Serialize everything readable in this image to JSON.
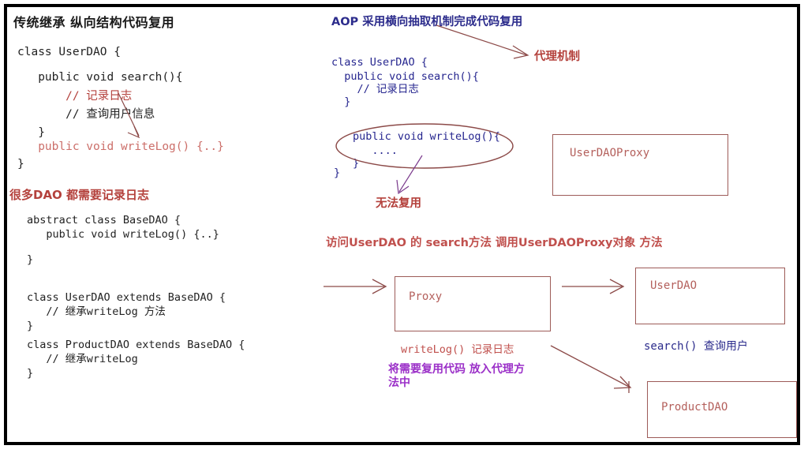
{
  "left_panel": {
    "heading": "传统继承 纵向结构代码复用",
    "code_block_1": [
      {
        "text": "class UserDAO {",
        "color": "dark"
      },
      {
        "text": "",
        "color": "dark"
      },
      {
        "text": "   public void search(){",
        "color": "dark"
      },
      {
        "text": "       // 记录日志",
        "color": "red"
      },
      {
        "text": "       // 查询用户信息",
        "color": "dark"
      },
      {
        "text": "   }",
        "color": "dark"
      },
      {
        "text": "",
        "color": "dark"
      },
      {
        "text": "   public void writeLog() {..}",
        "color": "salmon"
      },
      {
        "text": "}",
        "color": "dark"
      }
    ],
    "heading_2": "很多DAO 都需要记录日志",
    "code_block_2": [
      "abstract class BaseDAO {",
      "   public void writeLog() {..}",
      "",
      "}"
    ],
    "code_block_3": [
      "class UserDAO extends BaseDAO {",
      "   // 继承writeLog 方法",
      "}"
    ],
    "code_block_4": [
      "class ProductDAO extends BaseDAO {",
      "   // 继承writeLog",
      "}"
    ]
  },
  "right_panel": {
    "heading": "AOP 采用横向抽取机制完成代码复用",
    "proxy_mechanism_label": "代理机制",
    "code_block_1": [
      "class UserDAO {",
      "  public void search(){",
      "    // 记录日志",
      "  }"
    ],
    "ellipse_code": [
      "public void writeLog(){",
      "   ...."
    ],
    "ellipse_code_close": "}",
    "code_block_close": "}",
    "cannot_reuse_label": "无法复用",
    "flow_caption": "访问UserDAO 的 search方法 调用UserDAOProxy对象 方法",
    "proxy_note_code": "writeLog() 记录日志",
    "proxy_note_purple": "将需要复用代码 放入代理方\n法中",
    "search_note": "search() 查询用户"
  },
  "boxes": [
    {
      "id": "userdaoproxy-box",
      "label": "UserDAOProxy"
    },
    {
      "id": "proxy-box",
      "label": "Proxy"
    },
    {
      "id": "userdao-box",
      "label": "UserDAO"
    },
    {
      "id": "productdao-box",
      "label": "ProductDAO"
    }
  ],
  "colors": {
    "frame": "#000000",
    "red": "#b4413c",
    "salmon": "#cc6f6a",
    "box_border": "#9d5b58",
    "box_label": "#b4605c",
    "blue": "#2c2c8c",
    "purple": "#9b30c8",
    "arrow": "#8c4a48",
    "arrow_purple": "#7a3a8c"
  }
}
